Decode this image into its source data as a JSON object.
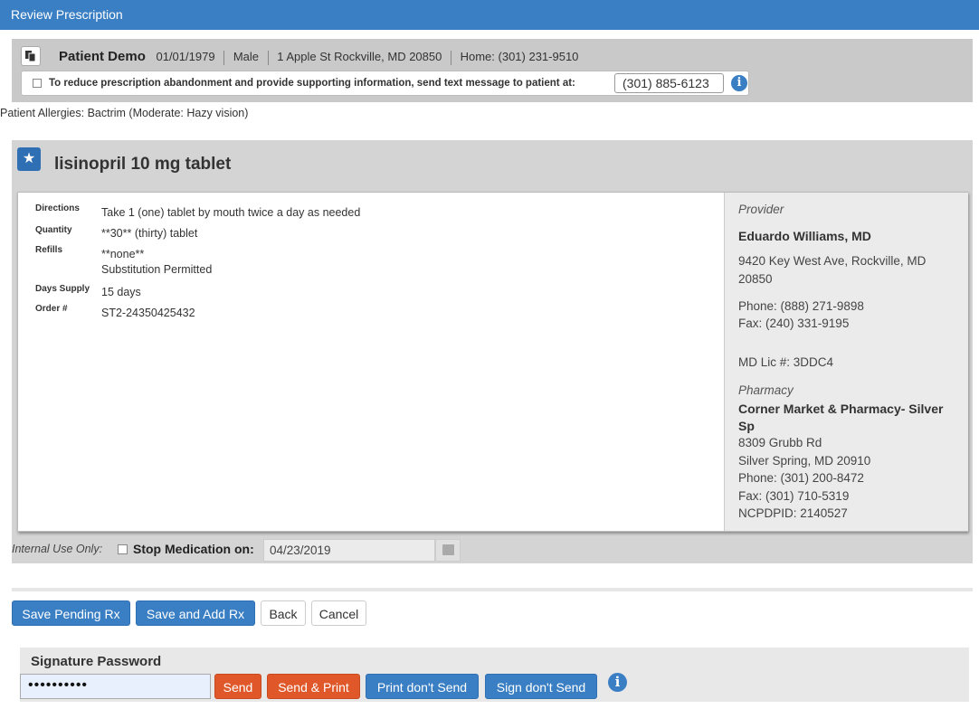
{
  "window": {
    "title": "Review Prescription"
  },
  "patient": {
    "name": "Patient Demo",
    "dob": "01/01/1979",
    "gender": "Male",
    "address": "1 Apple St Rockville, MD 20850",
    "home_phone": "Home: (301) 231-9510",
    "sms_prompt": "To reduce prescription abandonment and provide supporting information, send text message to patient at:",
    "sms_phone": "(301) 885-6123",
    "allergies": "Patient Allergies: Bactrim (Moderate: Hazy vision)"
  },
  "prescription": {
    "drug_name": "lisinopril 10 mg tablet",
    "fields": {
      "directions_label": "Directions",
      "directions_value": "Take 1 (one) tablet by mouth twice a day as needed",
      "quantity_label": "Quantity",
      "quantity_value": "**30** (thirty) tablet",
      "refills_label": "Refills",
      "refills_value": "**none**",
      "substitution": "Substitution Permitted",
      "days_supply_label": "Days Supply",
      "days_supply_value": "15 days",
      "order_label": "Order #",
      "order_value": "ST2-24350425432"
    }
  },
  "provider": {
    "heading": "Provider",
    "name": "Eduardo Williams, MD",
    "address_line1": "9420 Key West Ave, Rockville, MD",
    "address_line2": "20850",
    "phone": "Phone: (888) 271-9898",
    "fax": "Fax: (240) 331-9195",
    "license": "MD Lic #: 3DDC4"
  },
  "pharmacy": {
    "heading": "Pharmacy",
    "name_line1": "Corner Market & Pharmacy- Silver",
    "name_line2": "Sp",
    "address_line1": "8309 Grubb Rd",
    "address_line2": "Silver Spring, MD 20910",
    "phone": "Phone: (301) 200-8472",
    "fax": "Fax: (301) 710-5319",
    "ncpdpid": "NCPDPID: 2140527"
  },
  "options": {
    "internal_use_label": "Internal Use Only:",
    "stop_medication_label": "Stop Medication on:",
    "stop_date": "04/23/2019"
  },
  "actions": {
    "save_pending": "Save Pending Rx",
    "save_and_add": "Save and Add Rx",
    "back": "Back",
    "cancel": "Cancel"
  },
  "signature": {
    "label": "Signature Password",
    "password_mask": "••••••••••",
    "send": "Send",
    "send_print": "Send & Print",
    "print_dont_send": "Print don't Send",
    "sign_dont_send": "Sign don't Send"
  },
  "icons": {
    "info": "i",
    "star": "★"
  },
  "colors": {
    "primary": "#3a7fc4",
    "danger": "#e0582a",
    "panel": "#d4d4d4"
  }
}
